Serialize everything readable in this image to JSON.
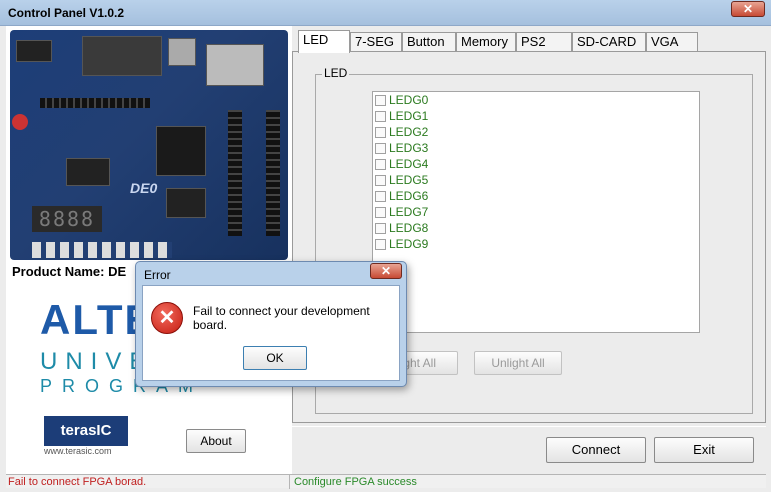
{
  "window": {
    "title": "Control Panel V1.0.2",
    "close_glyph": "✕"
  },
  "left": {
    "board_label": "DE0",
    "seven_seg_display": "8888",
    "product_name": "Product Name: DE",
    "altera_text": "ALTE",
    "university_text": "UNIVE",
    "program_text": "PROGRAM",
    "terasic_text": "terasIC",
    "terasic_url": "www.terasic.com",
    "about_label": "About"
  },
  "tabs": [
    {
      "label": "LED",
      "active": true
    },
    {
      "label": "7-SEG"
    },
    {
      "label": "Button"
    },
    {
      "label": "Memory"
    },
    {
      "label": "PS2"
    },
    {
      "label": "SD-CARD"
    },
    {
      "label": "VGA"
    }
  ],
  "led_group": {
    "title": "LED",
    "items": [
      "LEDG0",
      "LEDG1",
      "LEDG2",
      "LEDG3",
      "LEDG4",
      "LEDG5",
      "LEDG6",
      "LEDG7",
      "LEDG8",
      "LEDG9"
    ],
    "light_all_label": "Light All",
    "unlight_all_label": "Unlight All"
  },
  "bottom": {
    "connect_label": "Connect",
    "exit_label": "Exit"
  },
  "status": {
    "left": "Fail to connect FPGA borad.",
    "right": "Configure FPGA success"
  },
  "dialog": {
    "title": "Error",
    "close_glyph": "✕",
    "message": "Fail to connect your development board.",
    "ok_label": "OK",
    "icon_glyph": "✕"
  },
  "colors": {
    "status_error": "#c02020",
    "status_ok": "#2a8a2a",
    "led_label": "#2b7a1f",
    "titlebar": "#b9d1ea"
  }
}
